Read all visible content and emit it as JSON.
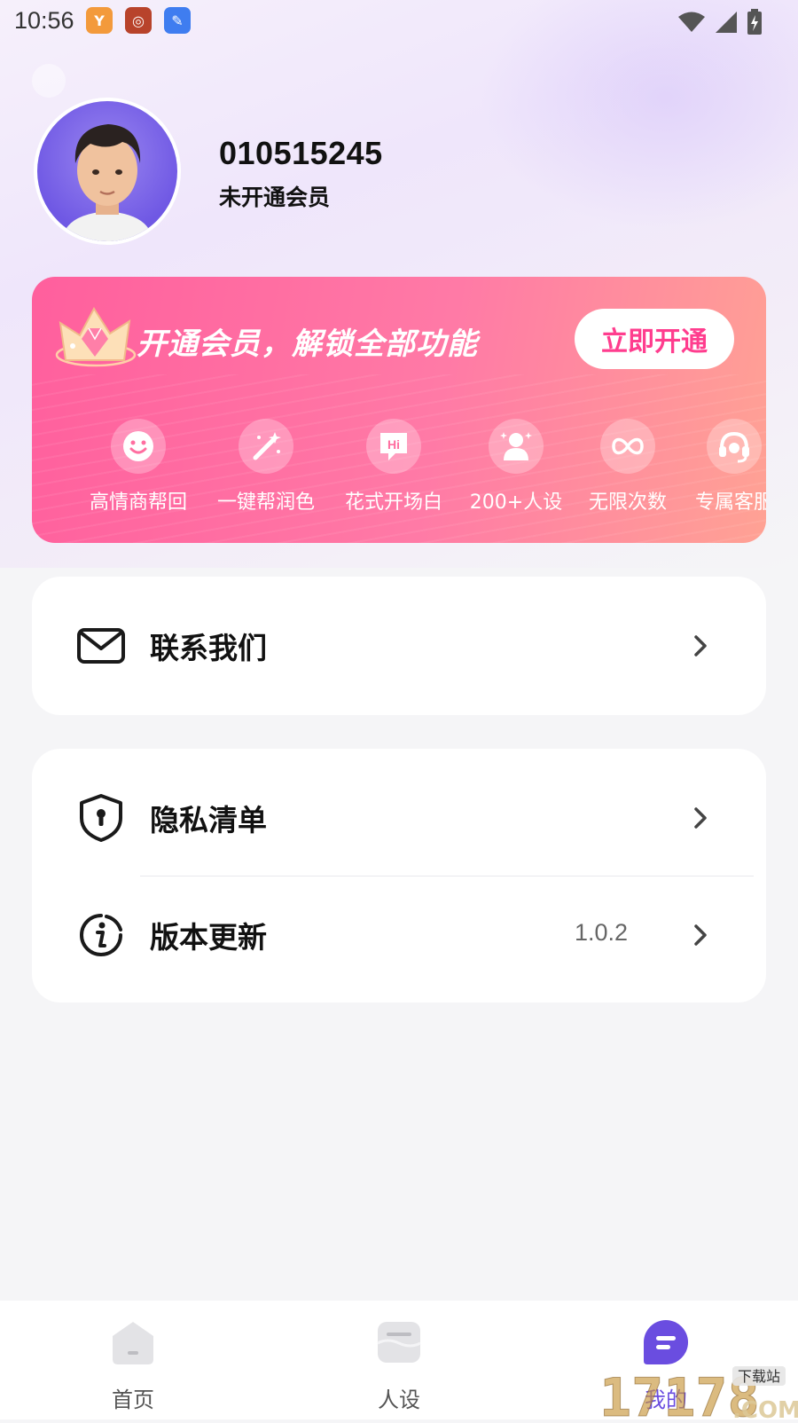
{
  "status_bar": {
    "time": "10:56"
  },
  "profile": {
    "user_id": "010515245",
    "member_status": "未开通会员"
  },
  "vip_card": {
    "title": "开通会员，解锁全部功能",
    "button_label": "立即开通",
    "features": [
      {
        "label": "高情商帮回",
        "icon": "smile-icon"
      },
      {
        "label": "一键帮润色",
        "icon": "magic-wand-icon"
      },
      {
        "label": "花式开场白",
        "icon": "hi-chat-icon"
      },
      {
        "label": "200+人设",
        "icon": "person-sparkle-icon"
      },
      {
        "label": "无限次数",
        "icon": "infinity-icon"
      },
      {
        "label": "专属客服",
        "icon": "headset-icon"
      }
    ]
  },
  "menu": {
    "contact_label": "联系我们",
    "privacy_label": "隐私清单",
    "version_label": "版本更新",
    "version_value": "1.0.2"
  },
  "bottom_nav": {
    "items": [
      {
        "label": "首页",
        "icon": "home-icon",
        "active": false
      },
      {
        "label": "人设",
        "icon": "persona-icon",
        "active": false
      },
      {
        "label": "我的",
        "icon": "profile-chat-icon",
        "active": true
      }
    ]
  },
  "watermark": {
    "text": "17178",
    "suffix": ".COM",
    "tag": "下载站"
  },
  "colors": {
    "accent": "#ff5f9d",
    "button_text": "#ff3d8e",
    "nav_active": "#6a4de0"
  }
}
